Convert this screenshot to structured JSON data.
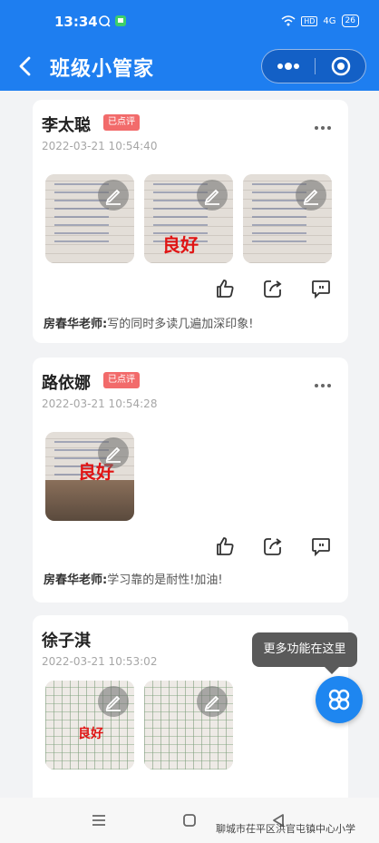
{
  "status_bar": {
    "time": "13:34",
    "hd": "HD",
    "signal": "4G",
    "battery": "26"
  },
  "nav_bar": {
    "back_icon": "back-arrow-icon",
    "title": "班级小管家",
    "more_icon": "more-dots-icon",
    "target_icon": "target-icon"
  },
  "posts": [
    {
      "name": "李太聪",
      "badge": "已点评",
      "date": "2022-03-21 10:54:40",
      "images": [
        {
          "mark": ""
        },
        {
          "mark": "良好"
        },
        {
          "mark": ""
        }
      ],
      "teacher": "房春华老师:",
      "comment": "写的同时多读几遍加深印象!"
    },
    {
      "name": "路依娜",
      "badge": "已点评",
      "date": "2022-03-21 10:54:28",
      "images": [
        {
          "mark": "良好"
        }
      ],
      "teacher": "房春华老师:",
      "comment": "学习靠的是耐性!加油!"
    },
    {
      "name": "徐子淇",
      "badge": "",
      "date": "2022-03-21 10:53:02",
      "images": [
        {
          "mark": "良好"
        },
        {
          "mark": ""
        }
      ]
    }
  ],
  "tooltip": "更多功能在这里",
  "fab_icon": "grid-apps-icon",
  "watermark": "聊城市茌平区洪官屯镇中心小学",
  "accent_color": "#1e7ef0",
  "badge_color": "#f26b6b"
}
